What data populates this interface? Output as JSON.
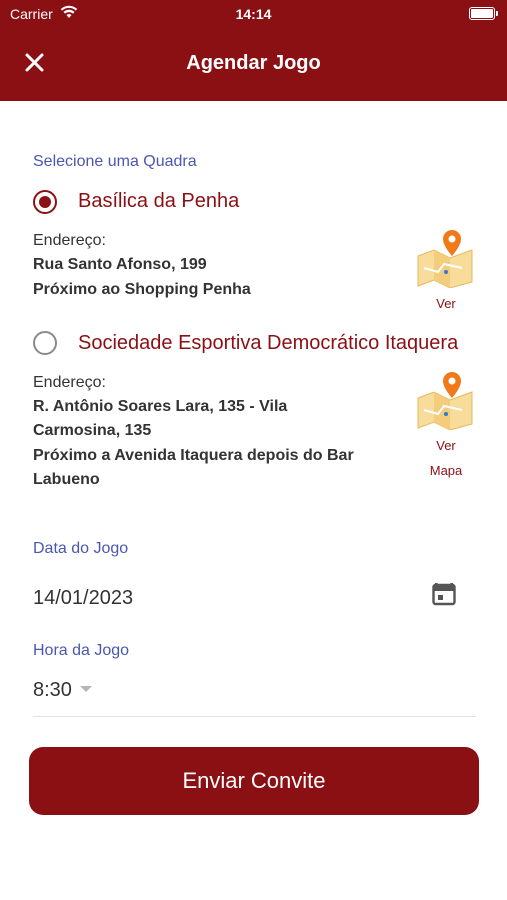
{
  "status_bar": {
    "carrier": "Carrier",
    "time": "14:14"
  },
  "header": {
    "title": "Agendar Jogo",
    "close_icon": "close-icon"
  },
  "court_section": {
    "label": "Selecione uma Quadra",
    "courts": [
      {
        "name": "Basílica da Penha",
        "selected": true,
        "address_label": "Endereço:",
        "address_lines": [
          "Rua Santo Afonso, 199",
          "Próximo ao Shopping Penha"
        ],
        "map_link": "Ver",
        "map_link_2": ""
      },
      {
        "name": "Sociedade Esportiva Democrático Itaquera",
        "selected": false,
        "address_label": "Endereço:",
        "address_lines": [
          "R. Antônio Soares Lara, 135 - Vila",
          "Carmosina, 135",
          "Próximo a Avenida Itaquera depois do Bar",
          "Labueno"
        ],
        "map_link": "Ver",
        "map_link_2": "Mapa"
      }
    ]
  },
  "date_field": {
    "label": "Data do Jogo",
    "value": "14/01/2023",
    "icon": "calendar-icon"
  },
  "time_field": {
    "label": "Hora da Jogo",
    "value": "8:30"
  },
  "submit_button": {
    "label": "Enviar Convite"
  },
  "colors": {
    "primary": "#8b1014",
    "label_blue": "#4a57b0",
    "map_orange": "#f07a1a"
  }
}
